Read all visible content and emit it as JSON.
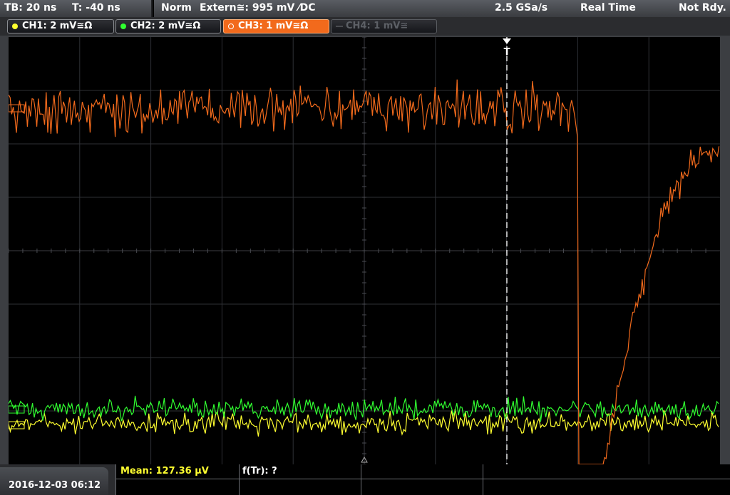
{
  "status": {
    "timebase": "TB: 20 ns",
    "trigger_time": "T: -40 ns",
    "mode": "Norm",
    "trigger_source": "Extern≅: 995 mV ⁄DC",
    "sample_rate": "2.5 GSa/s",
    "acquisition": "Real Time",
    "state": "Not Rdy."
  },
  "channels": [
    {
      "label": "CH1: 2 mV≅Ω",
      "color": "#ffff30",
      "state": "normal"
    },
    {
      "label": "CH2: 2 mV≅Ω",
      "color": "#30ff30",
      "state": "normal"
    },
    {
      "label": "CH3: 1 mV≅Ω",
      "color": "#f26a1c",
      "state": "active"
    },
    {
      "label": "CH4: 1 mV≅",
      "color": "#5d6066",
      "state": "off"
    }
  ],
  "trigger_marker": "T",
  "date_time": "2016-12-03 06:12",
  "measurements": {
    "mean": "Mean: 127.36 µV",
    "rise_freq": "f(Tr): ?"
  },
  "chart_data": {
    "type": "line",
    "x_divisions": 10,
    "y_divisions": 8,
    "series": [
      {
        "name": "CH1",
        "color": "#ffff30"
      },
      {
        "name": "CH2",
        "color": "#30ff30"
      },
      {
        "name": "CH3",
        "color": "#f26a1c"
      }
    ],
    "grid": true
  }
}
